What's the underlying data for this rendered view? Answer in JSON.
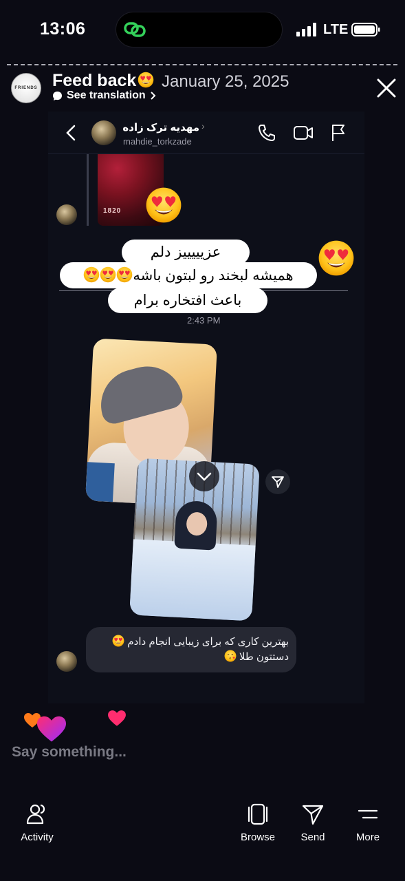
{
  "status_bar": {
    "time": "13:06",
    "network": "LTE",
    "icons": [
      "link-icon",
      "signal-icon",
      "battery-icon"
    ]
  },
  "story": {
    "title": "Feed back",
    "title_emoji": "heart-eyes-emoji",
    "date": "January 25, 2025",
    "see_translation": "See translation",
    "avatar_text": "FRIENDS"
  },
  "dm": {
    "name": "مهدیه ترک زاده",
    "handle": "mahdie_torkzade",
    "thumb_label": "1820",
    "sticker_lines": [
      "عزیییییز دلم",
      "همیشه لبخند رو لبتون باشه",
      "باعث افتخاره برام"
    ],
    "time": "2:43 PM",
    "reply_lines": [
      "بهترین کاری که برای زیبایی انجام دادم",
      "دستتون طلا"
    ]
  },
  "composer": {
    "placeholder": "Say something..."
  },
  "bottom_bar": {
    "activity": "Activity",
    "browse": "Browse",
    "send": "Send",
    "more": "More"
  },
  "colors": {
    "background": "#0b0b14",
    "dm_card": "#0d0f19",
    "bubble": "#262833",
    "heart_pink": "#ff2d6f",
    "heart_purple": "#b32dff",
    "heart_orange": "#ff7a1a"
  }
}
